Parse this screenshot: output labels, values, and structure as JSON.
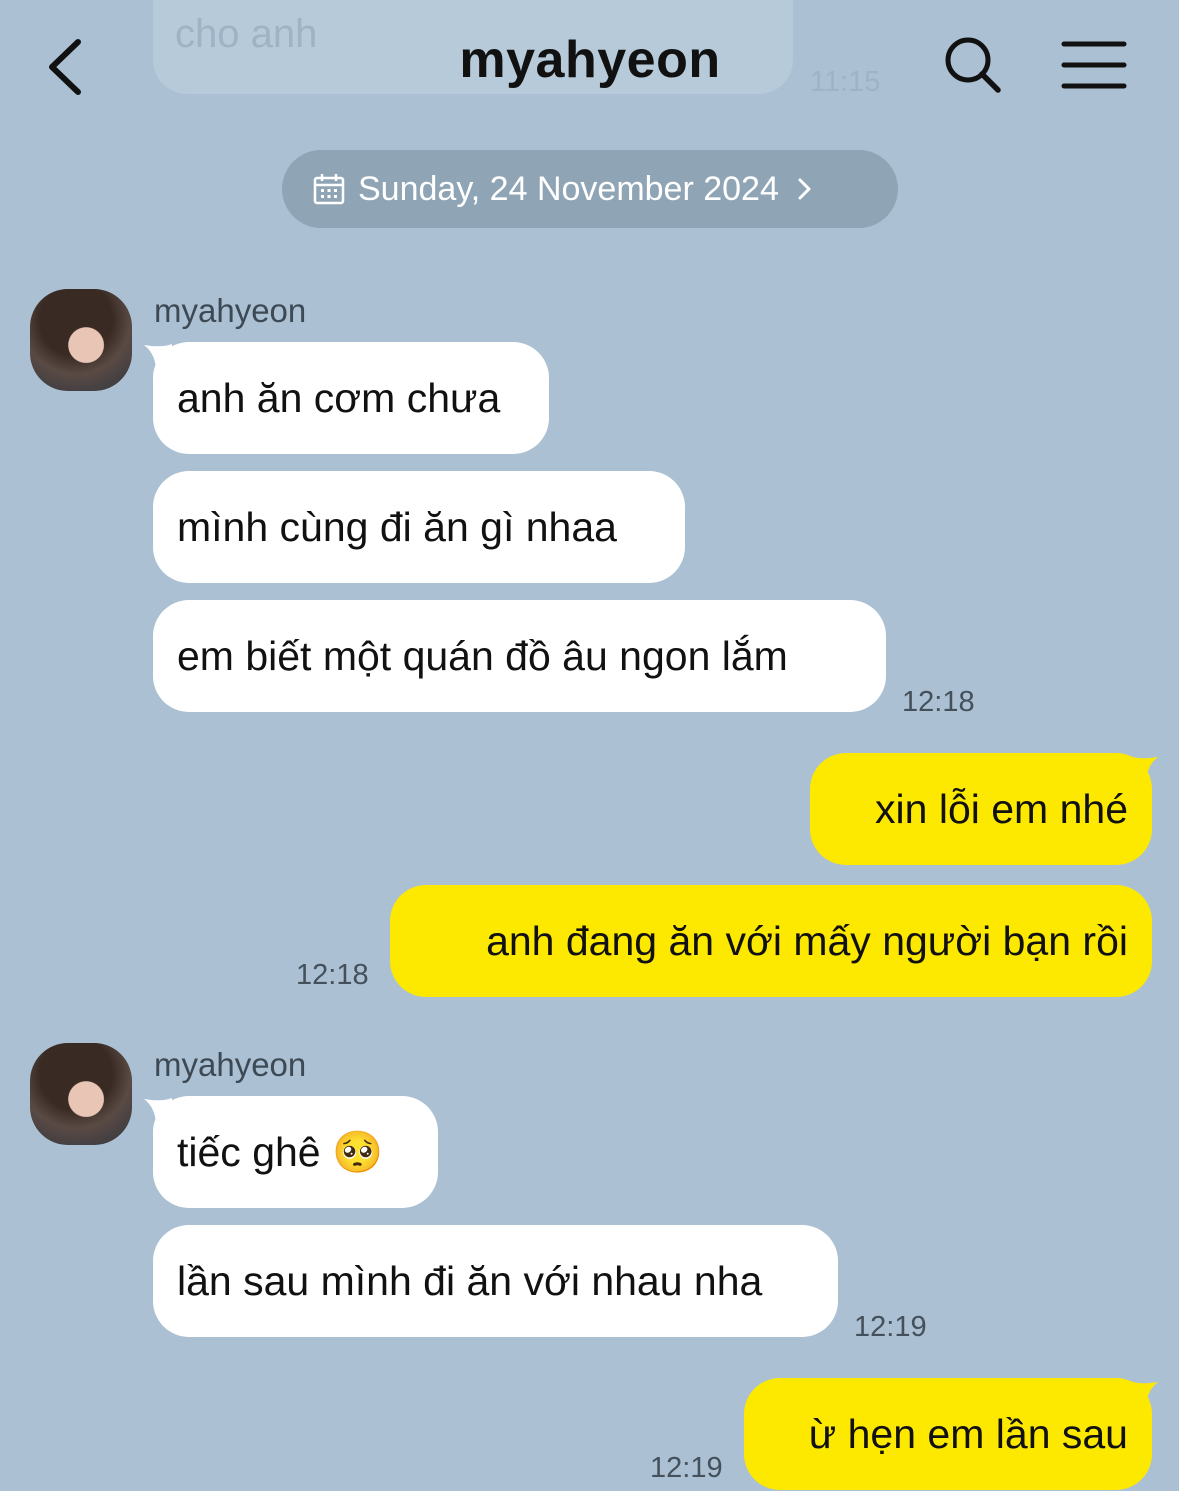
{
  "header": {
    "title": "myahyeon"
  },
  "prev_message": {
    "text": "cho anh",
    "time": "11:15"
  },
  "date_divider": {
    "label": "Sunday, 24 November 2024"
  },
  "groups": [
    {
      "sender": "myahyeon",
      "messages": [
        "anh ăn cơm chưa",
        "mình cùng đi ăn gì nhaa",
        "em biết một quán đồ âu ngon lắm"
      ],
      "time": "12:18"
    },
    {
      "sender": "me",
      "messages": [
        "xin lỗi em nhé",
        "anh đang ăn với mấy người bạn rồi"
      ],
      "time": "12:18"
    },
    {
      "sender": "myahyeon",
      "messages": [
        "tiếc ghê 🥺",
        "lần sau mình đi ăn với nhau nha"
      ],
      "time": "12:19"
    },
    {
      "sender": "me",
      "messages": [
        "ừ hẹn em lần sau"
      ],
      "time": "12:19"
    }
  ],
  "colors": {
    "background": "#abc1d3",
    "incoming_bubble": "#ffffff",
    "outgoing_bubble": "#fde800",
    "date_pill": "#8fa5b5"
  },
  "icons": [
    "back-arrow-icon",
    "search-icon",
    "menu-icon",
    "calendar-icon",
    "chevron-right-icon"
  ]
}
